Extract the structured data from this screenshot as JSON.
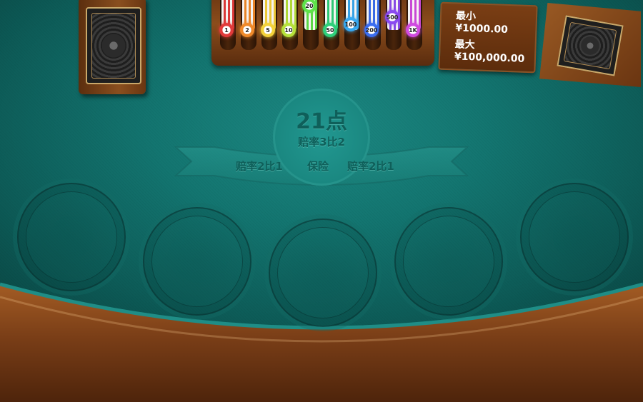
{
  "table": {
    "emblem_title": "21点",
    "emblem_subtitle": "赔率3比2",
    "banner_left": "赔率2比1",
    "banner_center": "保险",
    "banner_right": "赔率2比1"
  },
  "limits": {
    "min_label": "最小",
    "min_value": "¥1000.00",
    "max_label": "最大",
    "max_value": "¥100,000.00"
  },
  "chip_tray": {
    "chips": [
      {
        "label": "1",
        "color": "#e23a3a"
      },
      {
        "label": "2",
        "color": "#f08a2a"
      },
      {
        "label": "5",
        "color": "#f4d23a"
      },
      {
        "label": "10",
        "color": "#b6e23a"
      },
      {
        "label": "20",
        "color": "#5fe24a"
      },
      {
        "label": "50",
        "color": "#2ed07a"
      },
      {
        "label": "100",
        "color": "#36a8f0"
      },
      {
        "label": "200",
        "color": "#3a6df0"
      },
      {
        "label": "500",
        "color": "#8a4af0"
      },
      {
        "label": "1K",
        "color": "#d04ae0"
      }
    ]
  },
  "colors": {
    "felt": "#137570",
    "rail": "#7a3e17",
    "text_embossed": "#0f5f5a"
  }
}
